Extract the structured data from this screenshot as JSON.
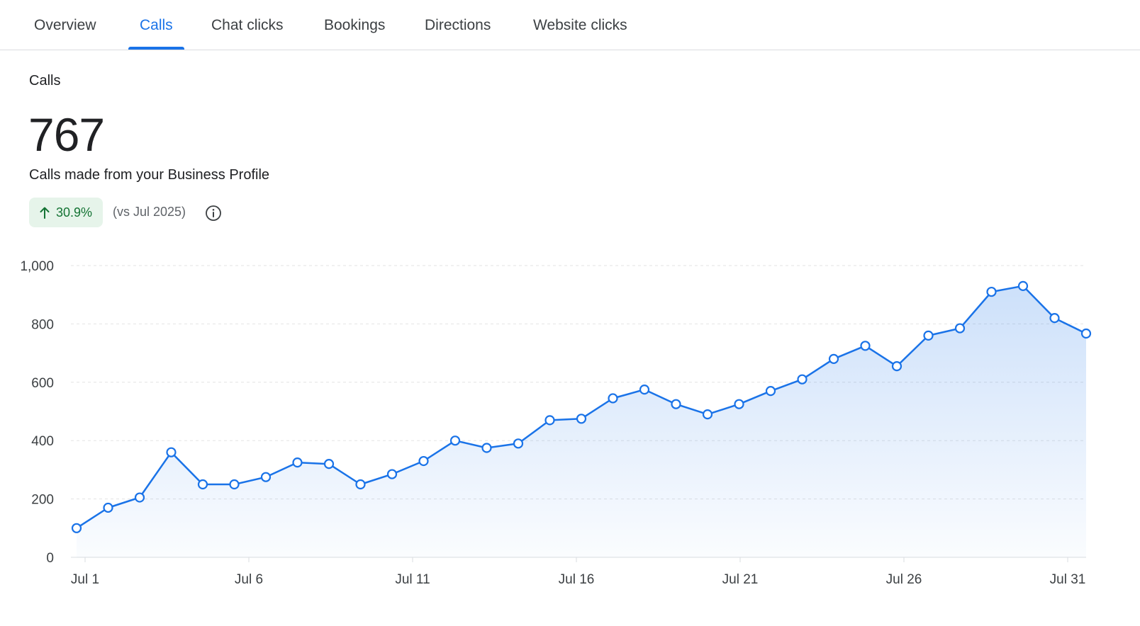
{
  "tabs": [
    {
      "label": "Overview",
      "active": false
    },
    {
      "label": "Calls",
      "active": true
    },
    {
      "label": "Chat clicks",
      "active": false
    },
    {
      "label": "Bookings",
      "active": false
    },
    {
      "label": "Directions",
      "active": false
    },
    {
      "label": "Website clicks",
      "active": false
    }
  ],
  "card": {
    "title": "Calls",
    "value": "767",
    "description": "Calls made from your Business Profile",
    "delta": "30.9%",
    "delta_direction": "up",
    "compare": "(vs Jul 2025)",
    "info_icon": "info-icon"
  },
  "colors": {
    "accent": "#1a73e8",
    "positive": "#137333",
    "positive_bg": "#e6f4ea"
  },
  "chart_data": {
    "type": "area",
    "x": [
      "Jul 1",
      "Jul 2",
      "Jul 3",
      "Jul 4",
      "Jul 5",
      "Jul 6",
      "Jul 7",
      "Jul 8",
      "Jul 9",
      "Jul 10",
      "Jul 11",
      "Jul 12",
      "Jul 13",
      "Jul 14",
      "Jul 15",
      "Jul 16",
      "Jul 17",
      "Jul 18",
      "Jul 19",
      "Jul 20",
      "Jul 21",
      "Jul 22",
      "Jul 23",
      "Jul 24",
      "Jul 25",
      "Jul 26",
      "Jul 27",
      "Jul 28",
      "Jul 29",
      "Jul 30",
      "Jul 31"
    ],
    "x_tick_labels": [
      "Jul 1",
      "Jul 6",
      "Jul 11",
      "Jul 16",
      "Jul 21",
      "Jul 26",
      "Jul 31"
    ],
    "y_tick_labels": [
      "0",
      "200",
      "400",
      "600",
      "800",
      "1,000"
    ],
    "series": [
      {
        "values": [
          100,
          170,
          205,
          360,
          250,
          250,
          275,
          325,
          320,
          250,
          285,
          330,
          400,
          375,
          390,
          470,
          475,
          545,
          575,
          525,
          490,
          525,
          570,
          610,
          680,
          725,
          655,
          760,
          785,
          910,
          930,
          820,
          767
        ]
      }
    ],
    "ylim": [
      0,
      1000
    ],
    "grid": true,
    "legend": "none"
  }
}
